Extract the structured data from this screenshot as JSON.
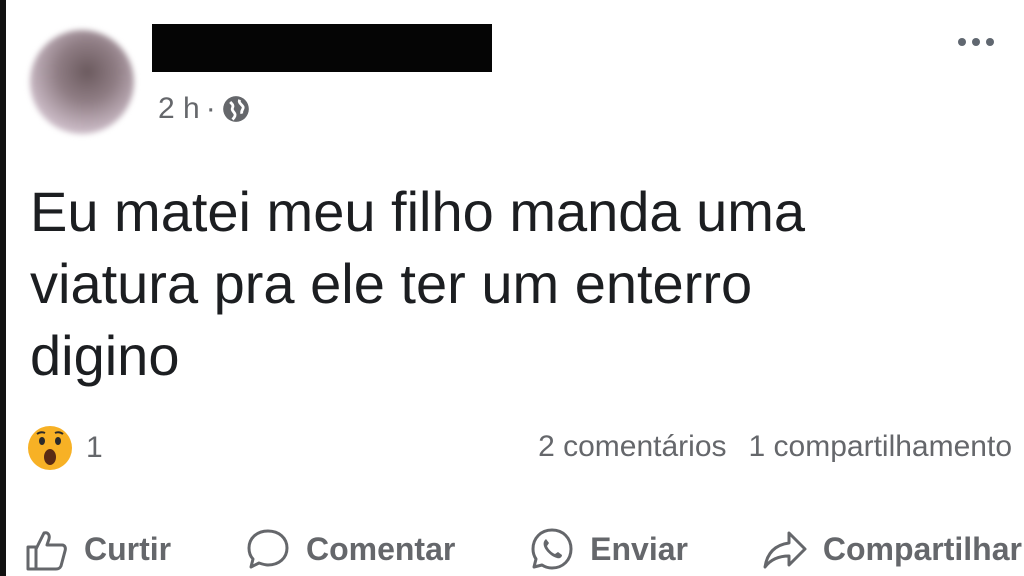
{
  "post": {
    "time": "2 h",
    "separator": "·",
    "text": "Eu matei meu filho manda uma\nviatura pra ele ter um enterro\ndigino",
    "reactions": {
      "icon": "wow-reaction-icon",
      "count": "1"
    },
    "stats": {
      "comments": "2 comentários",
      "shares": "1 compartilhamento"
    }
  },
  "actions": {
    "like": "Curtir",
    "comment": "Comentar",
    "send": "Enviar",
    "share": "Compartilhar"
  },
  "colors": {
    "text": "#1c1e21",
    "secondary": "#65676b",
    "reaction": "#f7b125"
  }
}
